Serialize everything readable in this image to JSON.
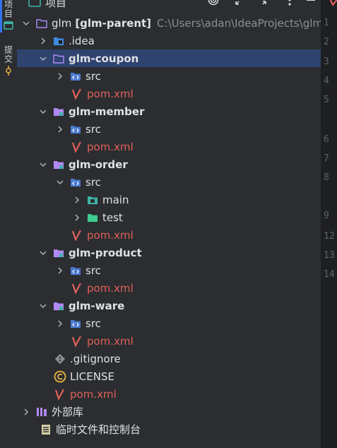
{
  "sidebar": {
    "project_label": "项目",
    "commit_label": "提交"
  },
  "header": {
    "title": "项目"
  },
  "tree": {
    "root_name": "glm",
    "root_module": "[glm-parent]",
    "root_path": "C:\\Users\\adan\\IdeaProjects\\glm",
    "idea": ".idea",
    "src": "src",
    "main": "main",
    "test": "test",
    "pom": "pom.xml",
    "gitignore": ".gitignore",
    "license": "LICENSE",
    "modules": {
      "coupon": "glm-coupon",
      "member": "glm-member",
      "order": "glm-order",
      "product": "glm-product",
      "ware": "glm-ware"
    },
    "external_libs": "外部库",
    "scratches": "临时文件和控制台"
  },
  "editor": {
    "line_numbers": [
      "1",
      "2",
      "3",
      "4",
      "5",
      "6",
      "7",
      "8",
      "9",
      "12",
      "13",
      "14"
    ]
  },
  "colors": {
    "background": "#2b2d30",
    "selection": "#2e436e",
    "accent": "#3574f0",
    "maven_red": "#e0605a",
    "folder_blue": "#4a7ad1",
    "module_purple": "#b189f5",
    "source_teal": "#3fb3a8"
  }
}
